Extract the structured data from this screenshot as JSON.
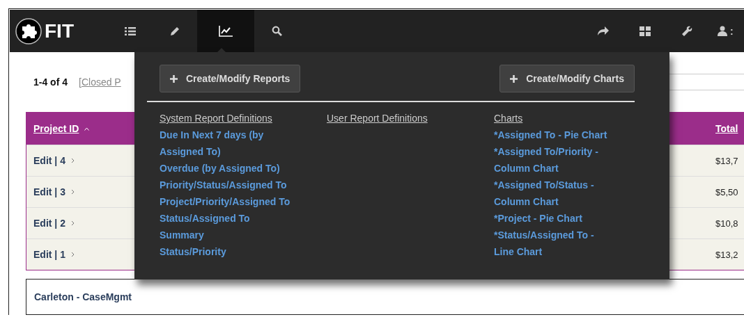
{
  "navbar": {
    "logo": "FIT",
    "items": [
      {
        "kind": "list",
        "selected": false
      },
      {
        "kind": "pencil",
        "selected": false
      },
      {
        "kind": "chart",
        "selected": true
      },
      {
        "kind": "search",
        "selected": false
      }
    ],
    "right_items": [
      {
        "kind": "share"
      },
      {
        "kind": "grid"
      },
      {
        "kind": "wrench"
      },
      {
        "kind": "user"
      }
    ],
    "user_label": ":"
  },
  "toolbar": {
    "count": "1-4 of 4",
    "filter_link": "[Closed P"
  },
  "table": {
    "columns": [
      {
        "label": "Project ID",
        "sorted": true
      },
      {
        "label": "Total",
        "sorted": false
      }
    ],
    "rows": [
      {
        "project_id": "Edit | 4",
        "total": "$13,7"
      },
      {
        "project_id": "Edit | 3",
        "total": "$5,50"
      },
      {
        "project_id": "Edit | 2",
        "total": "$10,8"
      },
      {
        "project_id": "Edit | 1",
        "total": "$13,2"
      }
    ]
  },
  "footer": {
    "title": "Carleton - CaseMgmt"
  },
  "dropdown": {
    "buttons": [
      "Create/Modify Reports",
      "Create/Modify Charts"
    ],
    "columns": [
      {
        "heading": "System Report Definitions",
        "links": [
          "Due In Next 7 days (by Assigned To)",
          "Overdue (by Assigned To)",
          "Priority/Status/Assigned To",
          "Project/Priority/Assigned To",
          "Status/Assigned To",
          "Summary",
          "Status/Priority"
        ]
      },
      {
        "heading": "User Report Definitions"
      },
      {
        "heading": "Charts",
        "links": [
          "*Assigned To - Pie Chart",
          "*Assigned To/Priority - Column Chart",
          "*Assigned To/Status - Column Chart",
          "*Project - Pie Chart",
          "*Status/Assigned To - Line Chart"
        ]
      }
    ]
  }
}
